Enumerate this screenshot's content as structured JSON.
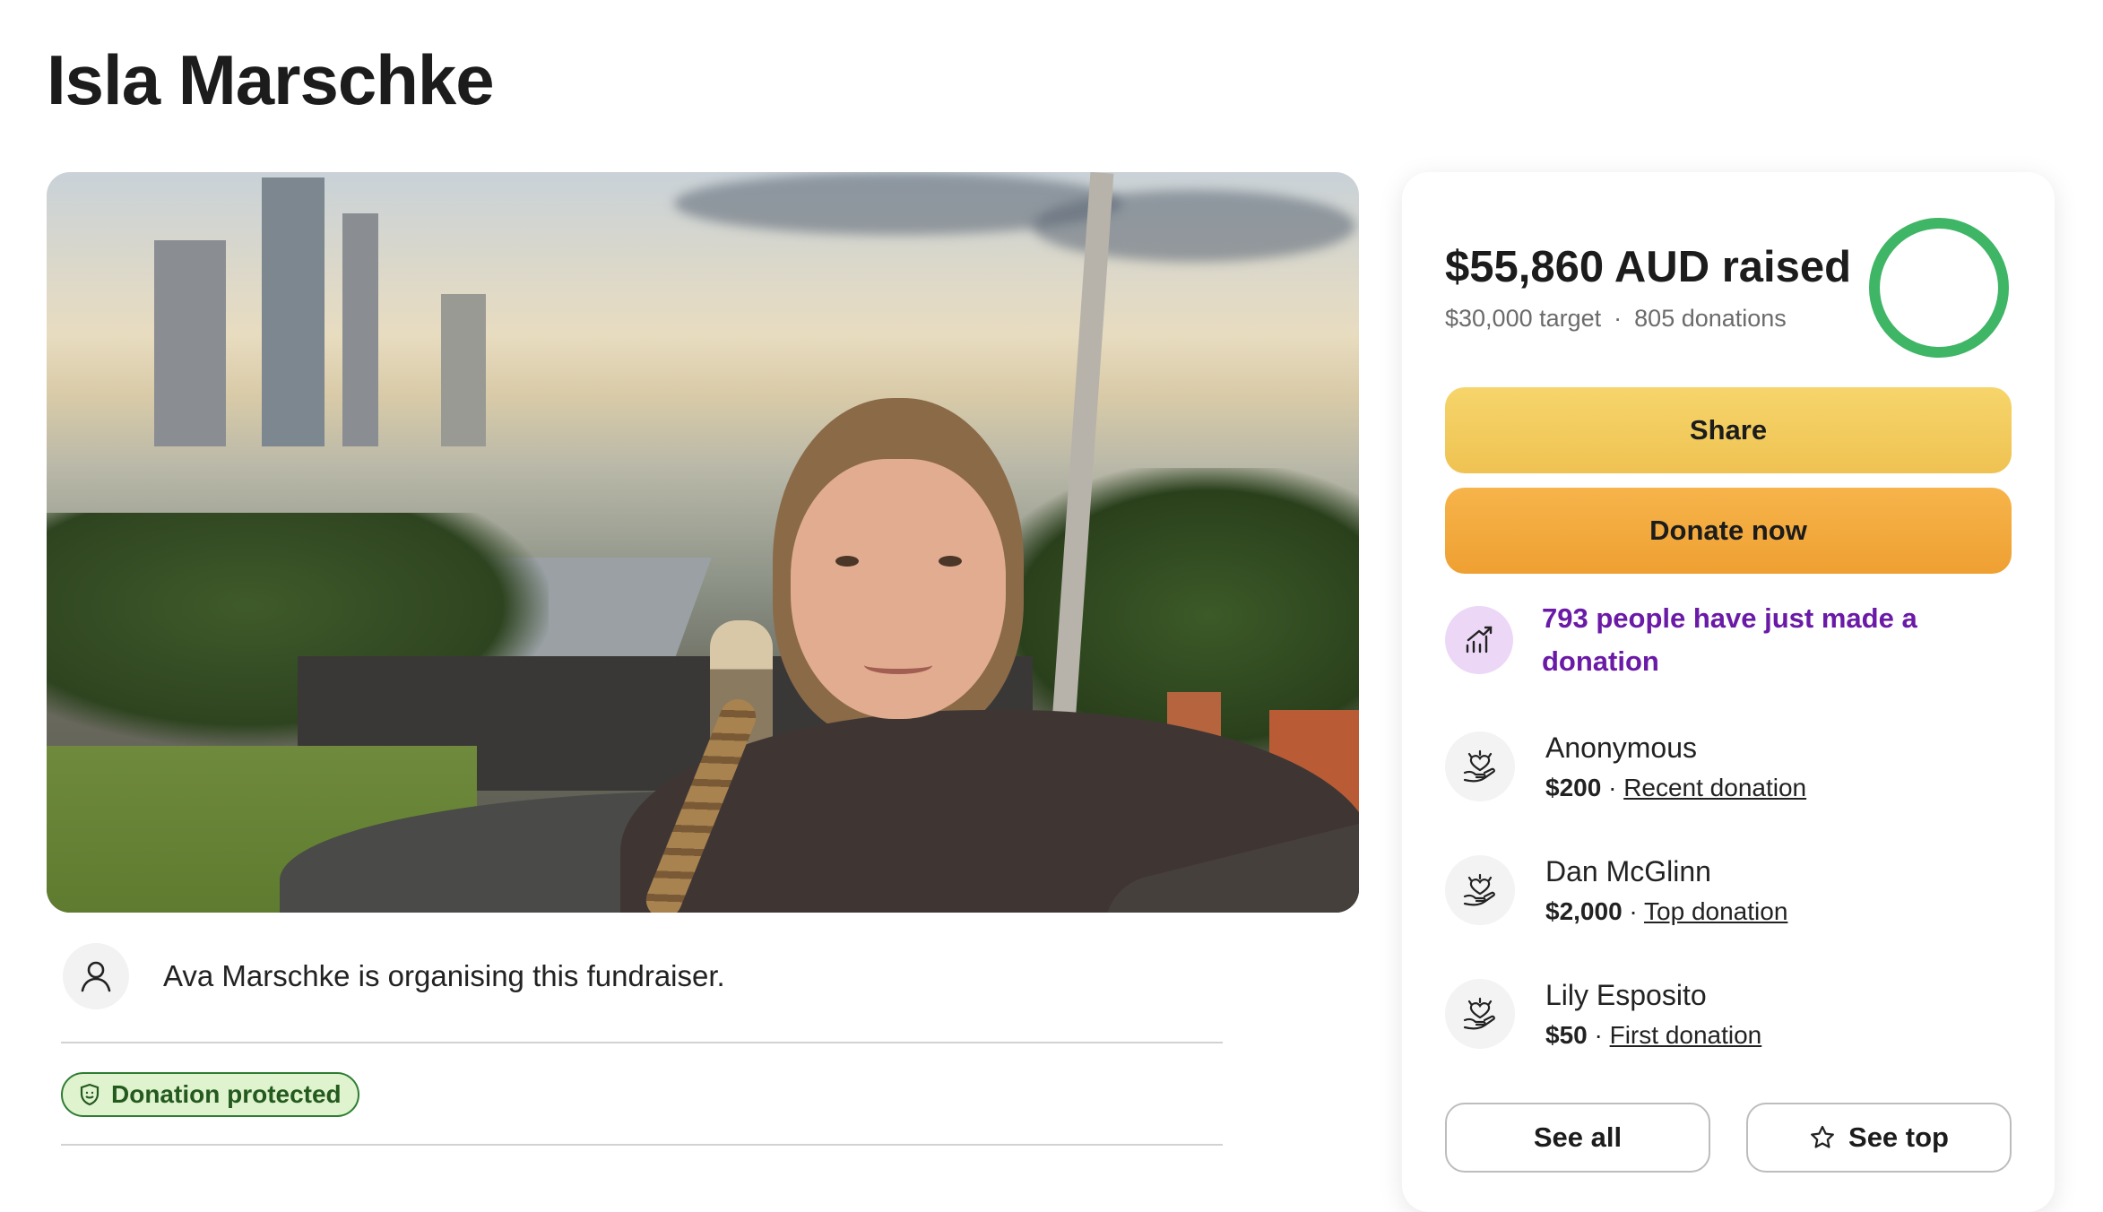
{
  "page": {
    "title": "Isla Marschke"
  },
  "organiser": {
    "text": "Ava Marschke is organising this fundraiser."
  },
  "badge": {
    "protected_label": "Donation protected"
  },
  "summary": {
    "raised": "$55,860 AUD raised",
    "target": "$30,000 target",
    "separator": "·",
    "donations": "805 donations",
    "progress_fraction": 1.0,
    "progress_color": "#3fb566"
  },
  "actions": {
    "share_label": "Share",
    "donate_label": "Donate now"
  },
  "trend": {
    "text": "793 people have just made a donation"
  },
  "donors": [
    {
      "name": "Anonymous",
      "amount": "$200",
      "sep": "·",
      "type": "Recent donation"
    },
    {
      "name": "Dan McGlinn",
      "amount": "$2,000",
      "sep": "·",
      "type": "Top donation"
    },
    {
      "name": "Lily Esposito",
      "amount": "$50",
      "sep": "·",
      "type": "First donation"
    }
  ],
  "footer_buttons": {
    "see_all": "See all",
    "see_top": "See top"
  },
  "icons": {
    "organiser": "user-icon",
    "protected": "shield-icon",
    "trend": "trending-up-icon",
    "donor": "heart-hand-icon",
    "star": "star-icon"
  }
}
